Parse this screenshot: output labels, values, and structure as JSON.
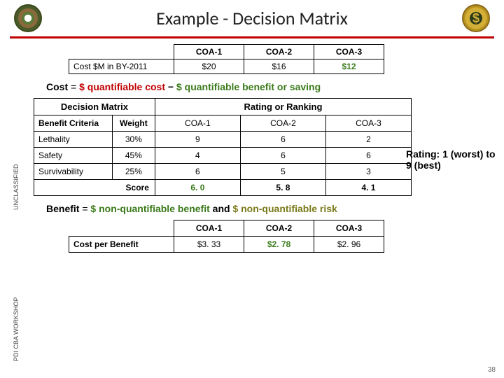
{
  "header": {
    "title": "Example - Decision Matrix",
    "seal_right_glyph": "$"
  },
  "rail": {
    "top": "UNCLASSIFIED",
    "bottom": "PDI CBA WORKSHOP"
  },
  "cost_table": {
    "cols": [
      "COA-1",
      "COA-2",
      "COA-3"
    ],
    "row_label": "Cost $M in BY-2011",
    "values": [
      "$20",
      "$16",
      "$12"
    ]
  },
  "formula_cost": {
    "lhs": "Cost",
    "eq": " = ",
    "t1": "$ quantifiable cost",
    "minus": " − ",
    "t2": "$ quantifiable benefit or saving"
  },
  "matrix": {
    "title_left": "Decision Matrix",
    "title_right": "Rating or Ranking",
    "h_benefit": "Benefit Criteria",
    "h_weight": "Weight",
    "coa": [
      "COA-1",
      "COA-2",
      "COA-3"
    ],
    "rows": [
      {
        "name": "Lethality",
        "weight": "30%",
        "v": [
          "9",
          "6",
          "2"
        ]
      },
      {
        "name": "Safety",
        "weight": "45%",
        "v": [
          "4",
          "6",
          "6"
        ]
      },
      {
        "name": "Survivability",
        "weight": "25%",
        "v": [
          "6",
          "5",
          "3"
        ]
      }
    ],
    "score_label": "Score",
    "score": [
      "6. 0",
      "5. 8",
      "4. 1"
    ]
  },
  "rating_note": "Rating: 1 (worst) to 9 (best)",
  "formula_benefit": {
    "lhs": "Benefit",
    "eq": " = ",
    "t1": "$ non-quantifiable benefit",
    "and": " and ",
    "t2": "$ non-quantifiable risk"
  },
  "cpb": {
    "cols": [
      "COA-1",
      "COA-2",
      "COA-3"
    ],
    "row_label": "Cost per Benefit",
    "values": [
      "$3. 33",
      "$2. 78",
      "$2. 96"
    ]
  },
  "page_number": "38",
  "chart_data": {
    "type": "table",
    "title": "Decision Matrix",
    "criteria": [
      "Lethality",
      "Safety",
      "Survivability"
    ],
    "weights": [
      0.3,
      0.45,
      0.25
    ],
    "alternatives": [
      "COA-1",
      "COA-2",
      "COA-3"
    ],
    "ratings": [
      [
        9,
        6,
        2
      ],
      [
        4,
        6,
        6
      ],
      [
        6,
        5,
        3
      ]
    ],
    "weighted_score": [
      6.0,
      5.8,
      4.1
    ],
    "cost_M_BY2011": [
      20,
      16,
      12
    ],
    "cost_per_benefit": [
      3.33,
      2.78,
      2.96
    ],
    "rating_scale": {
      "min": 1,
      "max": 9,
      "min_label": "worst",
      "max_label": "best"
    }
  }
}
